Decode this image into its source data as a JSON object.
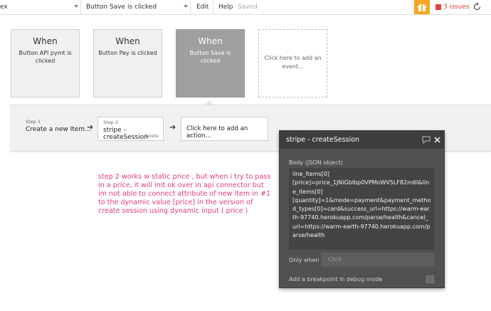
{
  "topbar": {
    "page_fragment": "ex",
    "event_selected": "Button Save is clicked",
    "edit_label": "Edit",
    "help_label": "Help",
    "saved_label": "Saved",
    "issues_label": "3 issues",
    "gift_color": "#f6a623",
    "issues_color": "#d9443c"
  },
  "events": [
    {
      "when": "When",
      "label": "Button API pymt is clicked"
    },
    {
      "when": "When",
      "label": "Button Pay is clicked"
    },
    {
      "when": "When",
      "label": "Button Save is clicked"
    },
    {
      "add_label": "Click here to add an event..."
    }
  ],
  "workflow": {
    "step1": {
      "number": "Step 1",
      "label": "Create a new Item..."
    },
    "step2": {
      "number": "Step 2",
      "label": "stripe - createSession",
      "delete_label": "delete"
    },
    "add_action_label": "Click here to add an action..."
  },
  "note": "step 2 works w static price , but when i try to pass\nin a price, it will init ok over in api connector but\nim not able to connect attribute of new item in #1\nto the dynamic value [price] in the version of\ncreate session using dynamic input ( price )",
  "panel": {
    "title": "stripe - createSession",
    "body_label": "Body (JSON object)",
    "body_value": "line_items[0]\n[price]=price_1JNiGbIbp0VPMoWV5LF82m6I&line_items[0]\n[quantity]=1&mode=payment&payment_method_types[0]=card&success_url=https://warm-earth-97740.herokuapp.com/parse/health&cancel_url=https://warm-earth-97740.herokuapp.com/parse/health",
    "only_when_label": "Only when",
    "only_when_placeholder": "Click",
    "breakpoint_label": "Add a breakpoint in debug mode"
  }
}
